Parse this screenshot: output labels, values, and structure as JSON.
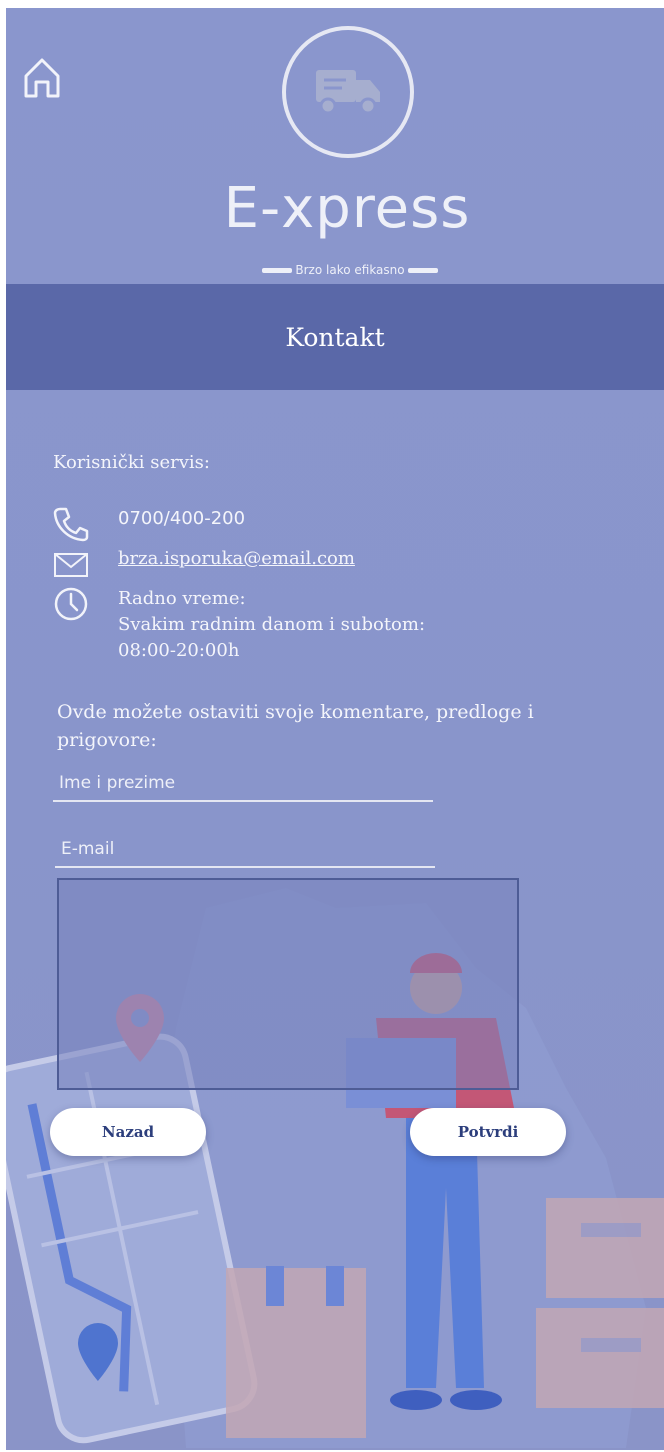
{
  "header": {
    "home_icon": "home-icon",
    "logo_icon": "delivery-truck-icon",
    "brand": "E-xpress",
    "tagline": "Brzo lako efikasno"
  },
  "page": {
    "title": "Kontakt"
  },
  "contact": {
    "customer_service_label": "Korisnički servis:",
    "phone": "0700/400-200",
    "email": "brza.isporuka@email.com",
    "hours_title": "Radno vreme:",
    "hours_days": "Svakim radnim danom i subotom:",
    "hours_time": "08:00-20:00h",
    "icons": [
      "phone-icon",
      "mail-icon",
      "clock-icon"
    ]
  },
  "form": {
    "prompt": "Ovde možete ostaviti svoje komentare, predloge i prigovore:",
    "name_placeholder": "Ime i prezime",
    "email_placeholder": "E-mail",
    "comment_value": ""
  },
  "buttons": {
    "back": "Nazad",
    "submit": "Potvrdi"
  },
  "colors": {
    "background": "#8a96cd",
    "title_band": "#5a68a8",
    "button_text": "#2c3e7c"
  }
}
